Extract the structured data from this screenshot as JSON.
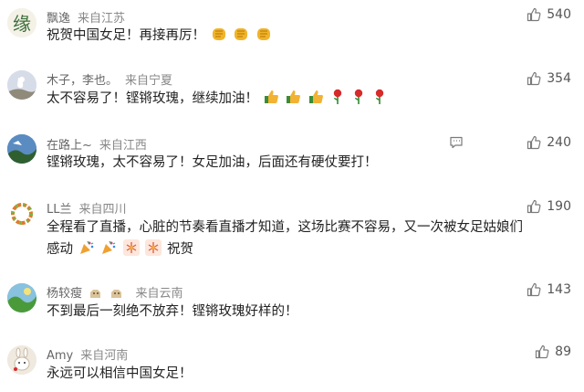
{
  "comments": [
    {
      "name": "飘逸",
      "location": "来自江苏",
      "text": "祝贺中国女足！再接再厉！",
      "likes": "540",
      "emoji": [
        "fist-emoji",
        "fist-emoji",
        "fist-emoji"
      ]
    },
    {
      "name": "木子，李也。",
      "location": "来自宁夏",
      "text": "太不容易了！铿锵玫瑰，继续加油！",
      "likes": "354",
      "emoji": [
        "thumbs-up-emoji",
        "thumbs-up-emoji",
        "thumbs-up-emoji",
        "rose-emoji",
        "rose-emoji",
        "rose-emoji"
      ]
    },
    {
      "name": "在路上~",
      "location": "来自江西",
      "text": "铿锵玫瑰，太不容易了！女足加油，后面还有硬仗要打！",
      "likes": "240",
      "emoji": []
    },
    {
      "name": "LL兰",
      "location": "来自四川",
      "text": "全程看了直播，心脏的节奏看直播才知道，这场比赛不容易，又一次被女足姑娘们",
      "text2": "感动",
      "text2_suffix": "祝贺",
      "likes": "190",
      "emoji": [
        "party-popper-emoji",
        "party-popper-emoji",
        "fireworks-emoji",
        "fireworks-emoji"
      ]
    },
    {
      "name": "杨较瘦",
      "location": "来自云南",
      "text": "不到最后一刻绝不放弃！铿锵玫瑰好样的！",
      "likes": "143",
      "emoji": []
    },
    {
      "name": "Amy",
      "location": "来自河南",
      "text": "永远可以相信中国女足！",
      "likes": "89",
      "emoji": []
    }
  ],
  "colors": {
    "text": "#222222",
    "meta": "#666666",
    "thumb": "#7a7a7a"
  }
}
